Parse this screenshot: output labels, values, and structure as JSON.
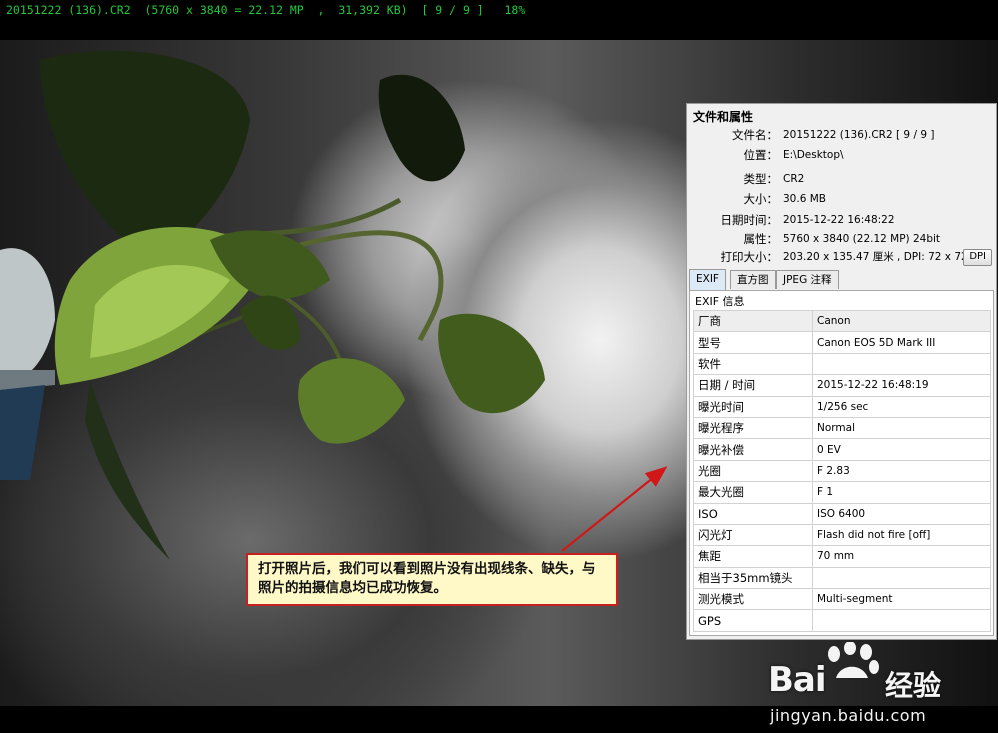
{
  "status_bar": {
    "text": "20151222 (136).CR2  (5760 x 3840 = 22.12 MP  ,  31,392 KB)  [ 9 / 9 ]   18%"
  },
  "panel": {
    "title": "文件和属性",
    "props": [
      {
        "key": "文件名：",
        "value": "20151222 (136).CR2  [ 9 / 9 ]"
      },
      {
        "key": "位置：",
        "value": "E:\\Desktop\\"
      },
      {
        "key": "类型：",
        "value": "CR2"
      },
      {
        "key": "大小：",
        "value": "30.6 MB"
      },
      {
        "key": "日期时间：",
        "value": "2015-12-22 16:48:22"
      },
      {
        "key": "属性：",
        "value": "5760 x 3840 (22.12 MP)  24bit"
      },
      {
        "key": "打印大小：",
        "value": "203.20 x 135.47 厘米 ,   DPI: 72 x 72"
      }
    ],
    "dpi_button": "DPI",
    "tabs": [
      {
        "label": "EXIF",
        "active": true
      },
      {
        "label": "直方图",
        "active": false
      },
      {
        "label": "JPEG 注释",
        "active": false
      }
    ],
    "exif_header": "EXIF 信息",
    "exif_rows": [
      {
        "key": "厂商",
        "value": "Canon"
      },
      {
        "key": "型号",
        "value": "Canon EOS 5D Mark III"
      },
      {
        "key": "软件",
        "value": ""
      },
      {
        "key": "日期 / 时间",
        "value": "2015-12-22 16:48:19"
      },
      {
        "key": "曝光时间",
        "value": "1/256 sec"
      },
      {
        "key": "曝光程序",
        "value": "Normal"
      },
      {
        "key": "曝光补偿",
        "value": "0 EV"
      },
      {
        "key": "光圈",
        "value": "F 2.83"
      },
      {
        "key": "最大光圈",
        "value": "F 1"
      },
      {
        "key": "ISO",
        "value": "ISO 6400"
      },
      {
        "key": "闪光灯",
        "value": "Flash did not fire [off]"
      },
      {
        "key": "焦距",
        "value": "70 mm"
      },
      {
        "key": "相当于35mm镜头",
        "value": ""
      },
      {
        "key": "测光模式",
        "value": "Multi-segment"
      },
      {
        "key": "GPS",
        "value": ""
      }
    ]
  },
  "annotation": {
    "text": "打开照片后，我们可以看到照片没有出现线条、缺失，与照片的拍摄信息均已成功恢复。",
    "border_color": "#c62020",
    "fill_color": "#fff9c8"
  },
  "watermark": {
    "brand": "Bai",
    "brand_suffix": "经验",
    "url": "jingyan.baidu.com"
  },
  "colors": {
    "status_text": "#22c83a",
    "arrow": "#d01818"
  }
}
